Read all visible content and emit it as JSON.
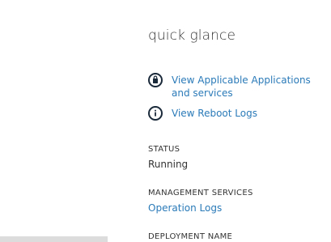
{
  "quick_glance": {
    "title": "quick glance",
    "links": {
      "applications": {
        "label": "View Applicable Applications and services",
        "icon": "shopping-bag-icon"
      },
      "reboot_logs": {
        "label": "View Reboot Logs",
        "icon": "info-icon"
      }
    },
    "status": {
      "label": "STATUS",
      "value": "Running"
    },
    "management_services": {
      "label": "MANAGEMENT SERVICES",
      "link": "Operation Logs"
    },
    "deployment_name": {
      "label": "DEPLOYMENT NAME"
    }
  },
  "colors": {
    "link": "#2a7ab8",
    "text": "#333333",
    "icon": "#1b2a3a",
    "scrollbar": "#dcdcdc"
  }
}
